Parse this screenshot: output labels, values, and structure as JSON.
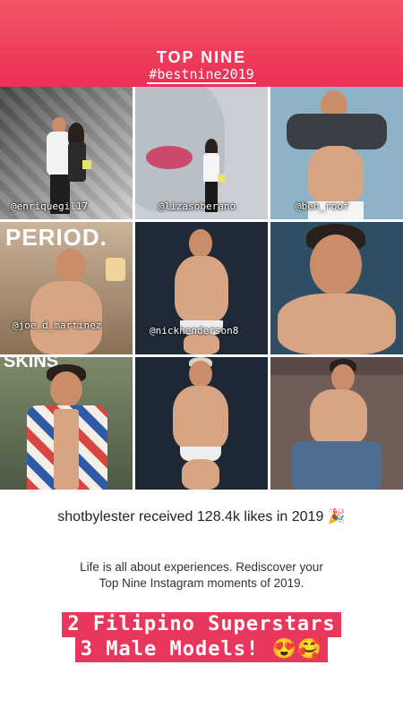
{
  "header": {
    "title": "TOP NINE",
    "hashtag": "#bestnine2019"
  },
  "colors": {
    "header_gradient_top": "#f05566",
    "header_gradient_bottom": "#ec2f55",
    "banner": "#e8365d"
  },
  "tiles": [
    {
      "tag": "@enriquegil17"
    },
    {
      "tag": "@lizasoberano"
    },
    {
      "tag": "@ben_roof"
    },
    {
      "tag": "@joe_d_martinez"
    },
    {
      "tag": "@nickhenderson8"
    },
    {
      "tag": ""
    },
    {
      "tag": ""
    },
    {
      "tag": ""
    },
    {
      "tag": ""
    }
  ],
  "stats": {
    "user": "shotbylester",
    "middle": " received ",
    "likes": "128.4k",
    "suffix": " likes in 2019 🎉"
  },
  "tagline": {
    "line1": "Life is all about experiences. Rediscover your",
    "line2": "Top Nine Instagram moments of 2019."
  },
  "banner": {
    "line1": "2 Filipino Superstars",
    "line2": "3 Male Models! 😍🥰"
  }
}
